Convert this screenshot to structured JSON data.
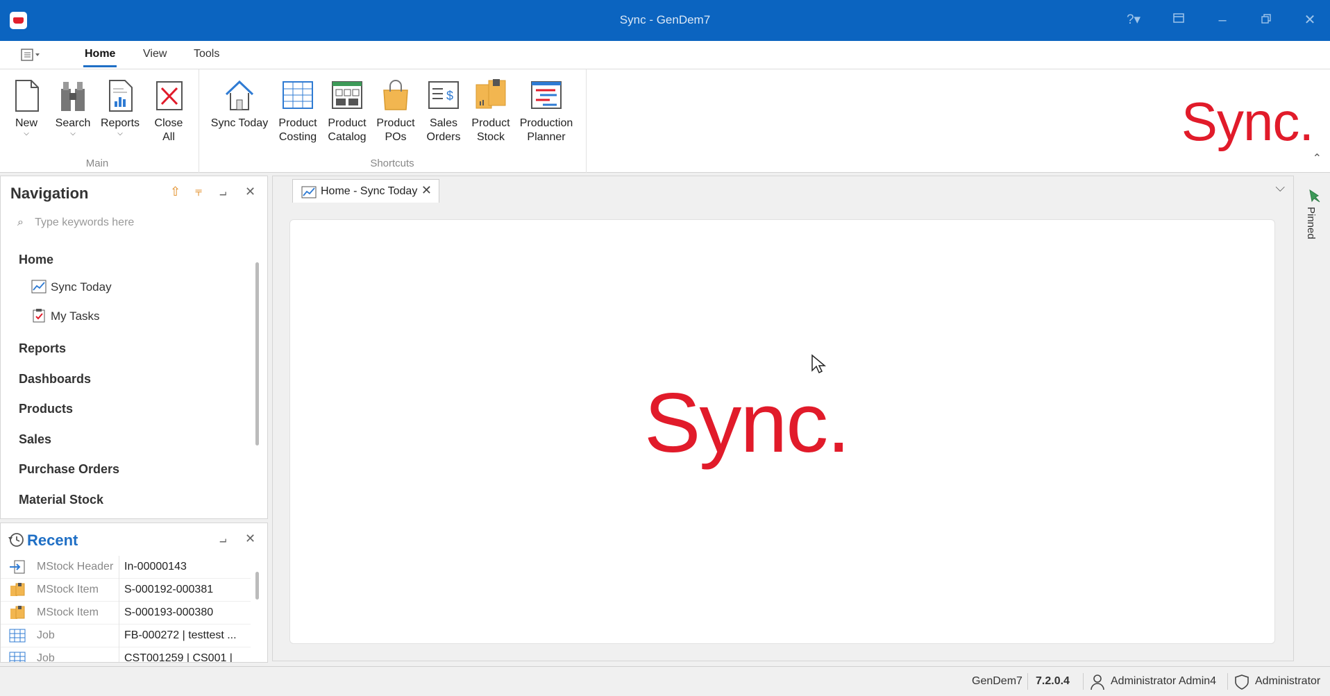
{
  "window": {
    "title": "Sync - GenDem7",
    "controls": [
      "help-icon",
      "ribbon-display-icon",
      "minimize-icon",
      "restore-icon",
      "close-icon"
    ]
  },
  "ribbon": {
    "tabs": [
      {
        "label": "Home",
        "active": true
      },
      {
        "label": "View",
        "active": false
      },
      {
        "label": "Tools",
        "active": false
      }
    ],
    "groups": {
      "main": {
        "label": "Main",
        "buttons": [
          {
            "label_line1": "New",
            "label_line2": "",
            "icon": "new-document-icon"
          },
          {
            "label_line1": "Search",
            "label_line2": "",
            "icon": "binoculars-icon"
          },
          {
            "label_line1": "Reports",
            "label_line2": "",
            "icon": "report-icon"
          },
          {
            "label_line1": "Close",
            "label_line2": "All",
            "icon": "close-all-icon"
          }
        ]
      },
      "shortcuts": {
        "label": "Shortcuts",
        "buttons": [
          {
            "label_line1": "Sync Today",
            "label_line2": "",
            "icon": "home-icon"
          },
          {
            "label_line1": "Product",
            "label_line2": "Costing",
            "icon": "grid-icon"
          },
          {
            "label_line1": "Product",
            "label_line2": "Catalog",
            "icon": "catalog-icon"
          },
          {
            "label_line1": "Product",
            "label_line2": "POs",
            "icon": "shopping-bag-icon"
          },
          {
            "label_line1": "Sales",
            "label_line2": "Orders",
            "icon": "sales-order-icon"
          },
          {
            "label_line1": "Product",
            "label_line2": "Stock",
            "icon": "stock-box-icon"
          },
          {
            "label_line1": "Production",
            "label_line2": "Planner",
            "icon": "planner-icon"
          }
        ]
      }
    },
    "brand": "Sync."
  },
  "navigation": {
    "title": "Navigation",
    "search_placeholder": "Type keywords here",
    "groups": [
      {
        "label": "Home",
        "items": [
          {
            "label": "Sync Today",
            "icon": "chart-icon"
          },
          {
            "label": "My Tasks",
            "icon": "clipboard-check-icon"
          }
        ]
      },
      {
        "label": "Reports",
        "items": []
      },
      {
        "label": "Dashboards",
        "items": []
      },
      {
        "label": "Products",
        "items": []
      },
      {
        "label": "Sales",
        "items": []
      },
      {
        "label": "Purchase Orders",
        "items": []
      },
      {
        "label": "Material Stock",
        "items": []
      }
    ]
  },
  "recent": {
    "title": "Recent",
    "rows": [
      {
        "type": "MStock Header",
        "value": "In-00000143",
        "icon": "import-icon"
      },
      {
        "type": "MStock Item",
        "value": "S-000192-000381",
        "icon": "stock-box-icon"
      },
      {
        "type": "MStock Item",
        "value": "S-000193-000380",
        "icon": "stock-box-icon"
      },
      {
        "type": "Job",
        "value": "FB-000272 | testtest ...",
        "icon": "grid-icon"
      },
      {
        "type": "Job",
        "value": "CST001259 | CS001 |",
        "icon": "grid-icon"
      }
    ]
  },
  "document": {
    "tab_label": "Home - Sync Today",
    "brand": "Sync."
  },
  "pinned": {
    "label": "Pinned"
  },
  "statusbar": {
    "database": "GenDem7",
    "version": "7.2.0.4",
    "user": "Administrator Admin4",
    "role": "Administrator"
  },
  "colors": {
    "titlebar": "#0b64c0",
    "brand_red": "#e11b2a",
    "accent_blue": "#1f6fc5"
  }
}
